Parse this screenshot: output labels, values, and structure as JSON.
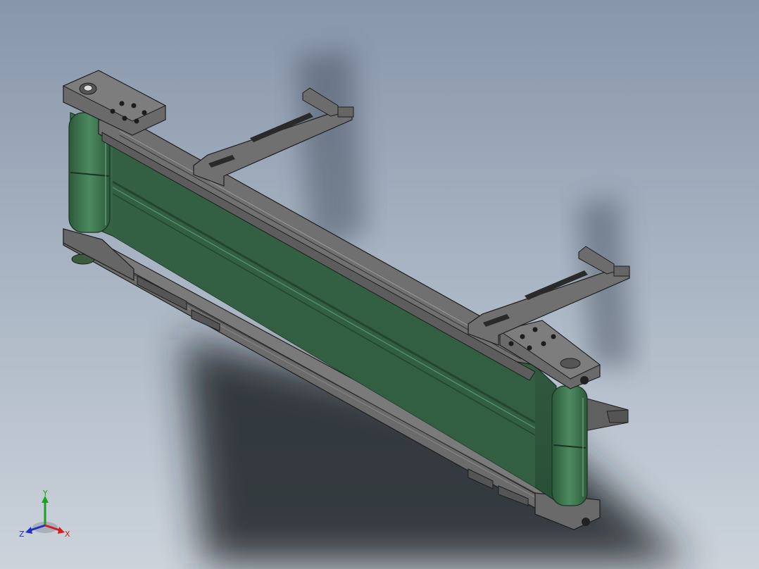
{
  "viewport": {
    "background_top": "#8796aa",
    "background_bottom": "#ccd3db"
  },
  "model": {
    "frame_color": "#6a6a6a",
    "belt_color": "#2f5a3e"
  },
  "triad": {
    "x_label": "X",
    "y_label": "Y",
    "z_label": "Z",
    "x_color": "#d02020",
    "y_color": "#20a020",
    "z_color": "#2030c0"
  }
}
